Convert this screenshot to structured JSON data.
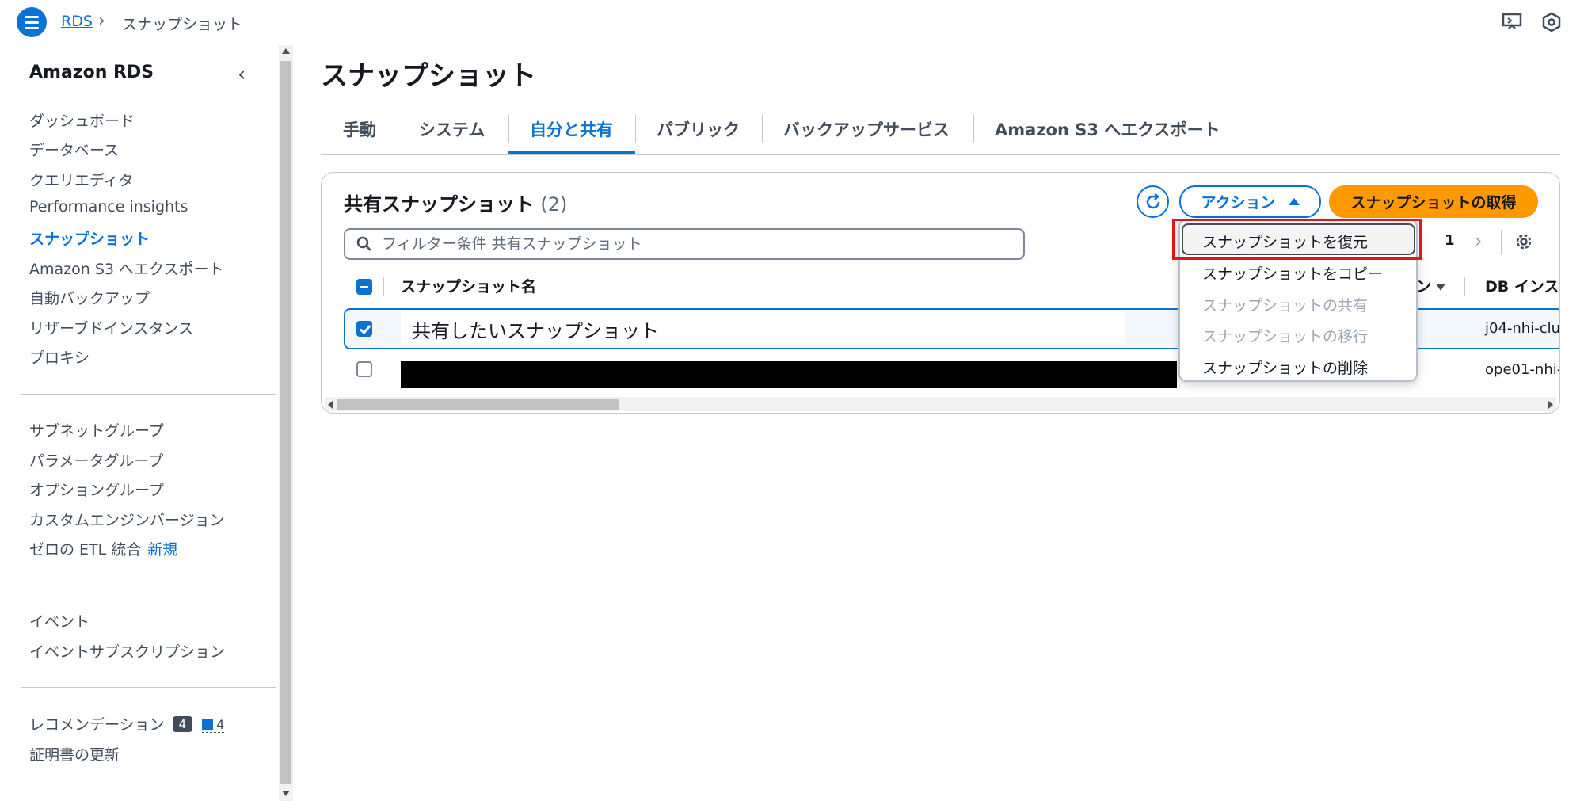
{
  "topbar": {
    "breadcrumb_root": "RDS",
    "breadcrumb_current": "スナップショット"
  },
  "sidebar": {
    "title": "Amazon RDS",
    "items_group1": [
      {
        "label": "ダッシュボード",
        "active": false
      },
      {
        "label": "データベース",
        "active": false
      },
      {
        "label": "クエリエディタ",
        "active": false
      },
      {
        "label": "Performance insights",
        "active": false
      },
      {
        "label": "スナップショット",
        "active": true
      },
      {
        "label": "Amazon S3 へエクスポート",
        "active": false
      },
      {
        "label": "自動バックアップ",
        "active": false
      },
      {
        "label": "リザーブドインスタンス",
        "active": false
      },
      {
        "label": "プロキシ",
        "active": false
      }
    ],
    "items_group2": [
      {
        "label": "サブネットグループ"
      },
      {
        "label": "パラメータグループ"
      },
      {
        "label": "オプショングループ"
      },
      {
        "label": "カスタムエンジンバージョン"
      },
      {
        "label": "ゼロの ETL 統合",
        "badge": "新規"
      }
    ],
    "items_group3": [
      {
        "label": "イベント"
      },
      {
        "label": "イベントサブスクリプション"
      }
    ],
    "items_group4": [
      {
        "label": "レコメンデーション",
        "count": "4",
        "info_count": "4"
      },
      {
        "label": "証明書の更新"
      }
    ]
  },
  "main": {
    "page_title": "スナップショット",
    "tabs": [
      {
        "label": "手動",
        "active": false
      },
      {
        "label": "システム",
        "active": false
      },
      {
        "label": "自分と共有",
        "active": true
      },
      {
        "label": "パブリック",
        "active": false
      },
      {
        "label": "バックアップサービス",
        "active": false
      },
      {
        "label": "Amazon S3 へエクスポート",
        "active": false
      }
    ],
    "panel": {
      "title": "共有スナップショット",
      "count": "(2)",
      "actions_label": "アクション",
      "primary_label": "スナップショットの取得",
      "filter_placeholder": "フィルター条件 共有スナップショット",
      "page_number": "1",
      "columns": [
        "スナップショット名",
        "DB インスタ"
      ],
      "hidden_column_fragment": "ン",
      "rows": [
        {
          "name": "共有したいスナップショット",
          "db_instance": "j04-nhi-clu",
          "selected": true
        },
        {
          "name": "",
          "db_instance": "ope01-nhi-",
          "selected": false,
          "redacted": true
        }
      ]
    },
    "action_menu": [
      {
        "label": "スナップショットを復元",
        "enabled": true,
        "highlighted": true
      },
      {
        "label": "スナップショットをコピー",
        "enabled": true
      },
      {
        "label": "スナップショットの共有",
        "enabled": false
      },
      {
        "label": "スナップショットの移行",
        "enabled": false
      },
      {
        "label": "スナップショットの削除",
        "enabled": true
      }
    ]
  },
  "colors": {
    "accent": "#0972d3",
    "primary_button": "#ff9900",
    "highlight": "#e5141b"
  }
}
